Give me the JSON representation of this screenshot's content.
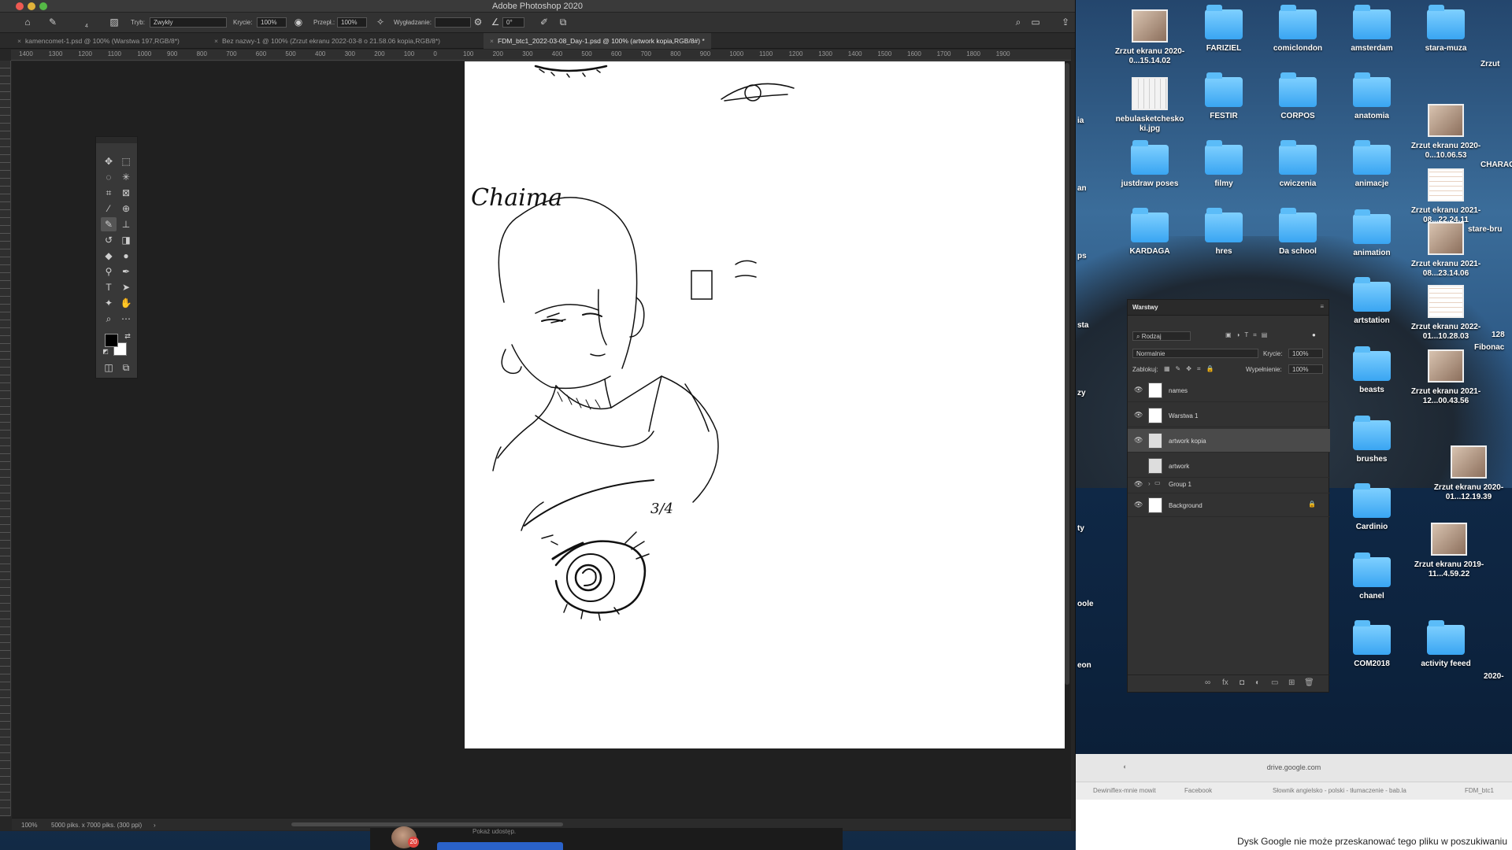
{
  "window": {
    "title": "Adobe Photoshop 2020"
  },
  "options_bar": {
    "mode_label": "Tryb:",
    "mode_value": "Zwykły",
    "opacity_label": "Krycie:",
    "opacity_value": "100%",
    "flow_label": "Przepł.:",
    "flow_value": "100%",
    "smoothing_label": "Wygładzanie:",
    "angle_value": "0°",
    "brush_size": "4"
  },
  "tabs": [
    {
      "label": "kamencomet-1.psd @ 100% (Warstwa 197,RGB/8*)"
    },
    {
      "label": "Bez nazwy-1 @ 100% (Zrzut ekranu 2022-03-8 o 21.58.06 kopia,RGB/8*)"
    },
    {
      "label": "FDM_btc1_2022-03-08_Day-1.psd @ 100% (artwork kopia,RGB/8#) *"
    }
  ],
  "ruler_ticks": [
    "1400",
    "1300",
    "1200",
    "1100",
    "1000",
    "900",
    "800",
    "700",
    "600",
    "500",
    "400",
    "300",
    "200",
    "100",
    "0",
    "100",
    "200",
    "300",
    "400",
    "500",
    "600",
    "700",
    "800",
    "900",
    "1000",
    "1100",
    "1200",
    "1300",
    "1400",
    "1500",
    "1600",
    "1700",
    "1800",
    "1900"
  ],
  "canvas": {
    "handwritten_title": "Chaima",
    "annotation": "3/4"
  },
  "status_bar": {
    "zoom": "100%",
    "doc_info": "5000 piks. x 7000 piks. (300 ppi)"
  },
  "layers_panel": {
    "title": "Warstwy",
    "filter_label": "Rodzaj",
    "blend_mode": "Normalnie",
    "opacity_label": "Krycie:",
    "opacity_value": "100%",
    "lock_label": "Zablokuj:",
    "fill_label": "Wypełnienie:",
    "fill_value": "100%",
    "layers": [
      {
        "name": "names",
        "visible": true,
        "selected": false
      },
      {
        "name": "Warstwa 1",
        "visible": true,
        "selected": false
      },
      {
        "name": "artwork kopia",
        "visible": true,
        "selected": true
      },
      {
        "name": "artwork",
        "visible": false,
        "selected": false
      },
      {
        "name": "Group 1",
        "visible": true,
        "selected": false,
        "group": true
      },
      {
        "name": "Background",
        "visible": true,
        "selected": false,
        "locked": true
      }
    ]
  },
  "desktop_icons": [
    {
      "label": "Zrzut ekranu 2020-0...15.14.02",
      "kind": "thumb"
    },
    {
      "label": "FARIZIEL",
      "kind": "folder"
    },
    {
      "label": "comiclondon",
      "kind": "folder"
    },
    {
      "label": "amsterdam",
      "kind": "folder"
    },
    {
      "label": "stara-muza",
      "kind": "folder"
    },
    {
      "label": "nebulasketchesko ki.jpg",
      "kind": "grid"
    },
    {
      "label": "FESTIR",
      "kind": "folder"
    },
    {
      "label": "CORPOS",
      "kind": "folder"
    },
    {
      "label": "anatomia",
      "kind": "folder"
    },
    {
      "label": "Zrzut ekranu 2020-0...10.06.53",
      "kind": "thumb"
    },
    {
      "label": "justdraw poses",
      "kind": "folder"
    },
    {
      "label": "filmy",
      "kind": "folder"
    },
    {
      "label": "cwiczenia",
      "kind": "folder"
    },
    {
      "label": "animacje",
      "kind": "folder"
    },
    {
      "label": "Zrzut ekranu 2021-08...22.24.11",
      "kind": "doc"
    },
    {
      "label": "KARDAGA",
      "kind": "folder"
    },
    {
      "label": "hres",
      "kind": "folder"
    },
    {
      "label": "Da school",
      "kind": "folder"
    },
    {
      "label": "animation",
      "kind": "folder"
    },
    {
      "label": "Zrzut ekranu 2021-08...23.14.06",
      "kind": "thumb"
    },
    {
      "label": "artstation",
      "kind": "folder"
    },
    {
      "label": "Zrzut ekranu 2022-01...10.28.03",
      "kind": "doc"
    },
    {
      "label": "beasts",
      "kind": "folder"
    },
    {
      "label": "Zrzut ekranu 2021-12...00.43.56",
      "kind": "thumb"
    },
    {
      "label": "brushes",
      "kind": "folder"
    },
    {
      "label": "Zrzut ekranu 2020-01...12.19.39",
      "kind": "thumb"
    },
    {
      "label": "Cardinio",
      "kind": "folder"
    },
    {
      "label": "Zrzut ekranu 2019-11...4.59.22",
      "kind": "thumb"
    },
    {
      "label": "chanel",
      "kind": "folder"
    },
    {
      "label": "COM2018",
      "kind": "folder"
    },
    {
      "label": "activity feeed",
      "kind": "folder"
    }
  ],
  "desktop_partial_labels": [
    "ia",
    "an",
    "ps",
    "sta",
    "zy",
    "ty",
    "oole",
    "eon",
    "CHARAC",
    "stare-bru",
    "Fibonac",
    "128",
    "Zrzut",
    "2020-"
  ],
  "browser": {
    "url": "drive.google.com",
    "bookmarks": [
      "Dewiniflex-mnie mowit",
      "Facebook",
      "Słownik angielsko - polski - tłumaczenie - bab.la",
      "FDM_btc1"
    ],
    "message": "Dysk Google nie może przeskanować tego pliku w poszukiwaniu"
  },
  "dock": {
    "badge": "20",
    "caption": "Pokaż udostęp."
  }
}
